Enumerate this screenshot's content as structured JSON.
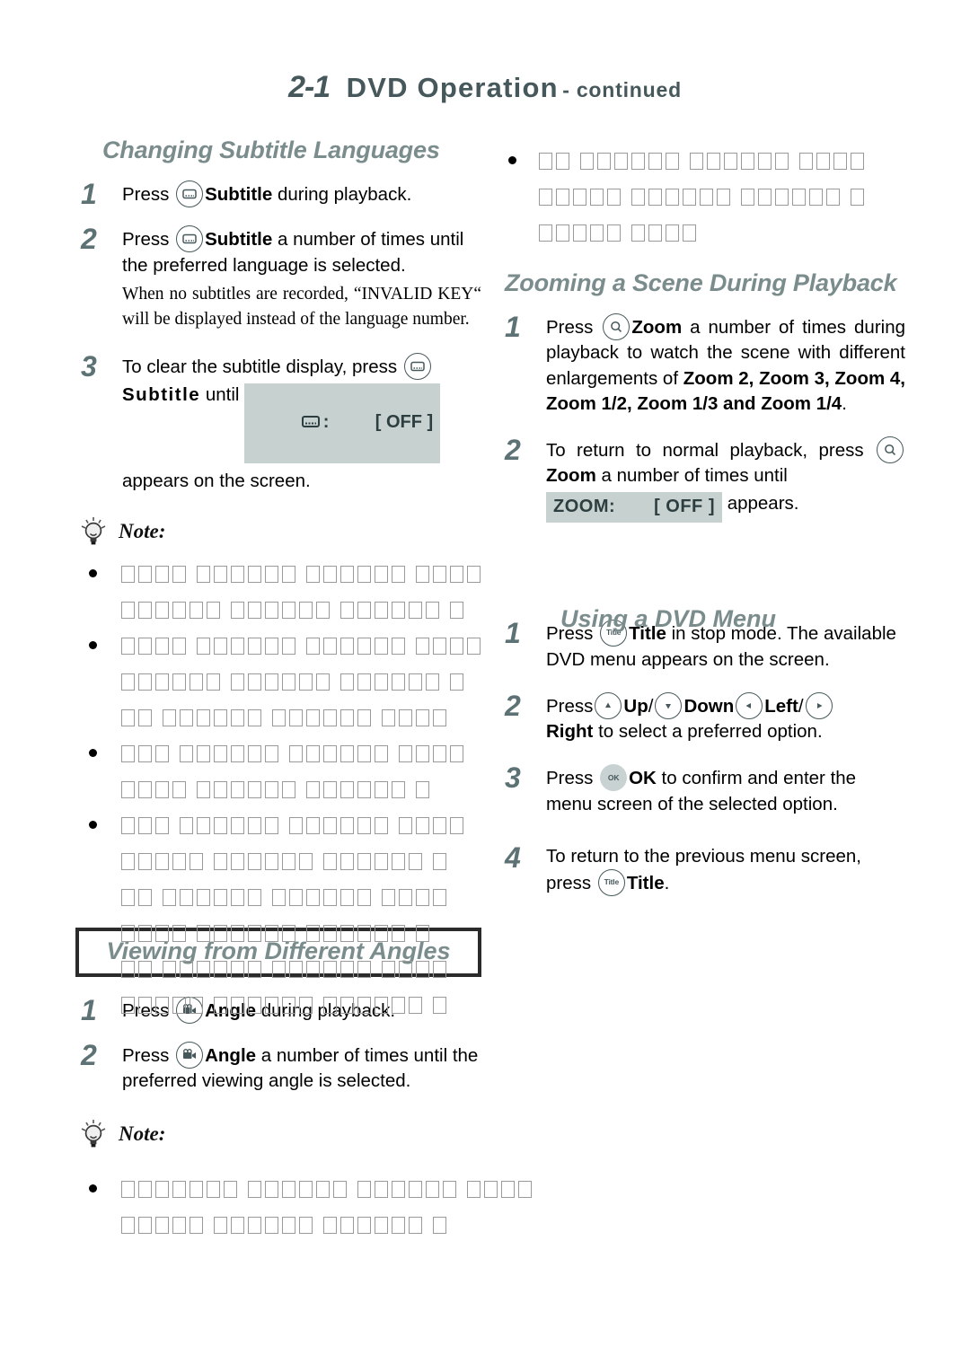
{
  "header": {
    "section_number": "2-1",
    "title": "DVD Operation",
    "suffix": "- continued"
  },
  "colors": {
    "heading_teal": "#7b8c8c",
    "header_slate": "#46585b",
    "step_number": "#5d7275",
    "osd_background": "#c7d1cf",
    "osd_text": "#2d3e41",
    "tofu_gray": "#7d7d7d"
  },
  "left_column": {
    "section_1": {
      "heading": "Changing Subtitle Languages",
      "steps": [
        {
          "number": "1",
          "press_word": "Press",
          "icon": "subtitle-icon",
          "key_label": "Subtitle",
          "text_after": " during playback."
        },
        {
          "number": "2",
          "press_word": "Press",
          "icon": "subtitle-icon",
          "key_label": "Subtitle",
          "text_after": " a number of times until the preferred language is selected.",
          "serif_note": "When no subtitles are recorded, “INVALID KEY“ will be displayed instead of the language number."
        },
        {
          "number": "3",
          "text_before": "To clear the subtitle display, press ",
          "icon": "subtitle-icon",
          "key_label": "Subtitle",
          "text_middle": " until ",
          "osd_icon": "subtitle-icon",
          "osd_colon": ":",
          "osd_value": "[ OFF ]",
          "text_after": "appears on the screen."
        }
      ]
    },
    "note_top": {
      "icon": "lightbulb-icon",
      "label": "Note:"
    },
    "section_2": {
      "heading": "Viewing from Different Angles",
      "steps": [
        {
          "number": "1",
          "press_word": "Press",
          "icon": "angle-camera-icon",
          "key_label": "Angle",
          "text_after": " during playback."
        },
        {
          "number": "2",
          "press_word": "Press",
          "icon": "angle-camera-icon",
          "key_label": "Angle",
          "text_after": " a number of times until the preferred viewing angle is selected."
        }
      ]
    },
    "note_bottom": {
      "icon": "lightbulb-icon",
      "label": "Note:"
    }
  },
  "right_column": {
    "section_zoom": {
      "heading": "Zooming a Scene During Playback",
      "steps": [
        {
          "number": "1",
          "press_word": "Press",
          "icon": "zoom-icon",
          "key_label": "Zoom",
          "text_a": " a number of times during playback to watch the scene with different enlargements of ",
          "bold_list": "Zoom 2, Zoom 3, Zoom 4, Zoom 1/2, Zoom 1/3 and Zoom 1/4",
          "text_b": "."
        },
        {
          "number": "2",
          "text_before": "To return to normal playback, press ",
          "icon": "zoom-icon",
          "key_label": "Zoom",
          "text_middle": " a number of times until ",
          "osd_label": "ZOOM:",
          "osd_value": "[ OFF ]",
          "text_after": " appears."
        }
      ]
    },
    "section_menu": {
      "heading": "Using a DVD Menu",
      "steps": [
        {
          "number": "1",
          "press_word": "Press",
          "icon": "title-icon",
          "key_label": "Title",
          "text_after": " in stop mode. The available DVD menu appears on the screen."
        },
        {
          "number": "2",
          "press_word": "Press",
          "keys": [
            {
              "icon": "arrow-up-icon",
              "label": "Up"
            },
            {
              "icon": "arrow-down-icon",
              "label": "Down"
            },
            {
              "icon": "arrow-left-icon",
              "label": "Left"
            },
            {
              "icon": "arrow-right-icon",
              "label": "Right"
            }
          ],
          "separator": "/",
          "text_after": " to select a preferred option."
        },
        {
          "number": "3",
          "press_word": "Press",
          "icon": "ok-icon",
          "key_label": "OK",
          "text_after": " to confirm and enter the menu screen of the selected option."
        },
        {
          "number": "4",
          "text_before": "To return to the previous menu screen, press ",
          "icon": "title-icon",
          "key_label": "Title",
          "text_after": "."
        }
      ]
    }
  },
  "unrendered_text_blocks": {
    "description": "Note body paragraphs whose glyphs failed to render (shown as empty boxes).",
    "note_top_bullet_1_lines": [
      20,
      19
    ],
    "note_top_bullet_2_lines": [
      20,
      19,
      18
    ],
    "note_top_bullet_3_lines": [
      19,
      17
    ],
    "note_top_bullet_4_lines": [
      19,
      18,
      18,
      17,
      18,
      18
    ],
    "note_right_bullet_lines": [
      18,
      18,
      9
    ],
    "note_bottom_bullet_lines": [
      23,
      18
    ]
  }
}
